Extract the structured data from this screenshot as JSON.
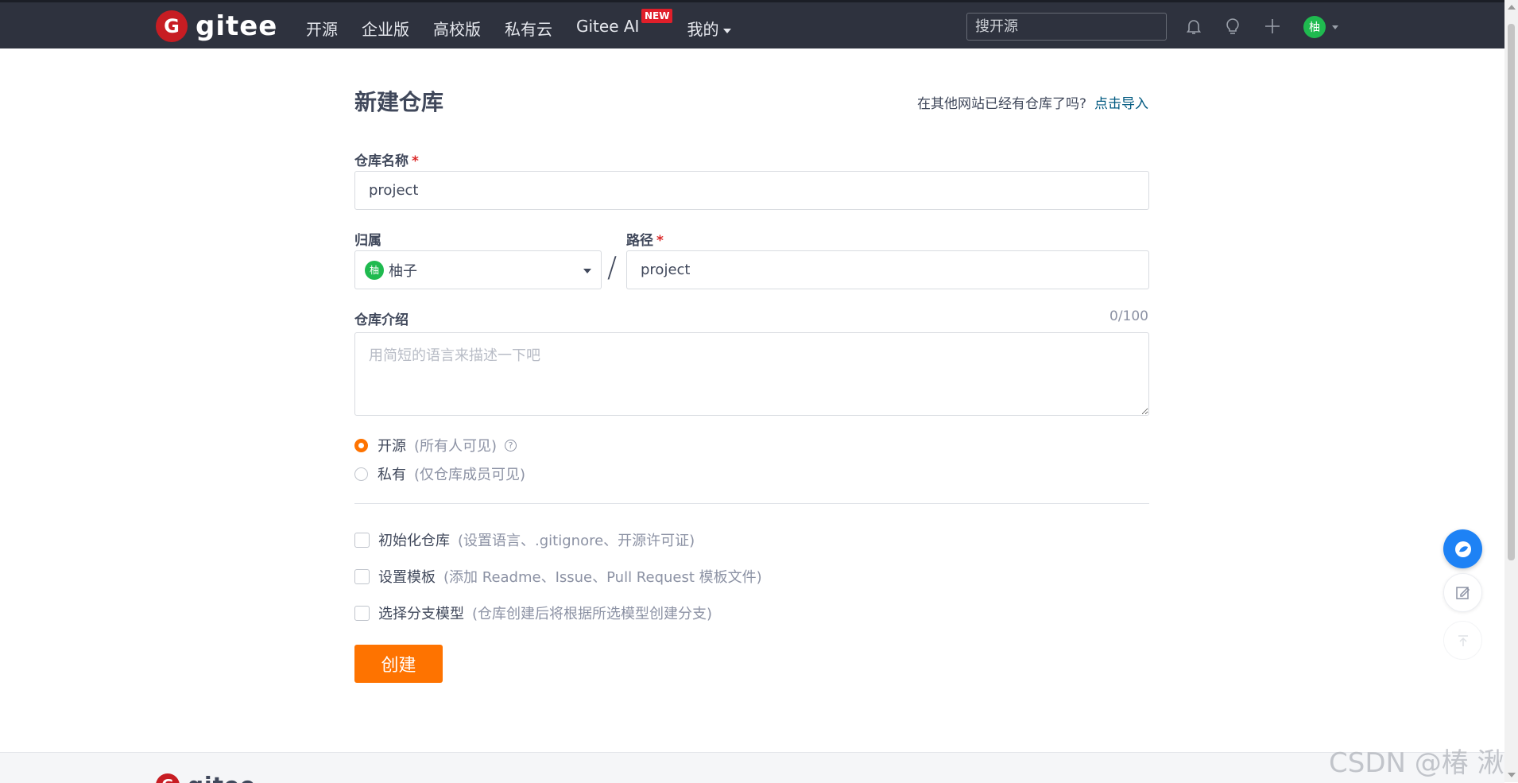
{
  "nav": {
    "logo_text": "gitee",
    "logo_letter": "G",
    "items": [
      {
        "label": "开源"
      },
      {
        "label": "企业版"
      },
      {
        "label": "高校版"
      },
      {
        "label": "私有云"
      },
      {
        "label": "Gitee AI",
        "badge": "NEW"
      },
      {
        "label": "我的"
      }
    ],
    "search_placeholder": "搜开源",
    "avatar_text": "柚"
  },
  "form": {
    "title": "新建仓库",
    "import_prompt": "在其他网站已经有仓库了吗?",
    "import_link": "点击导入",
    "repo_name_label": "仓库名称",
    "repo_name_value": "project",
    "required_mark": "*",
    "owner_label": "归属",
    "owner_avatar": "柚",
    "owner_name": "柚子",
    "separator": "/",
    "path_label": "路径",
    "path_value": "project",
    "desc_label": "仓库介绍",
    "desc_counter": "0/100",
    "desc_placeholder": "用简短的语言来描述一下吧",
    "visibility": [
      {
        "label": "开源",
        "hint": "(所有人可见)",
        "checked": true
      },
      {
        "label": "私有",
        "hint": "(仅仓库成员可见)",
        "checked": false
      }
    ],
    "help_glyph": "?",
    "options": [
      {
        "label": "初始化仓库",
        "hint": "(设置语言、.gitignore、开源许可证)"
      },
      {
        "label": "设置模板",
        "hint": "(添加 Readme、Issue、Pull Request 模板文件)"
      },
      {
        "label": "选择分支模型",
        "hint": "(仓库创建后将根据所选模型创建分支)"
      }
    ],
    "submit_label": "创建"
  },
  "footer": {
    "logo_text": "gitee"
  },
  "watermark": "CSDN @椿 湫",
  "colors": {
    "accent": "#fe7300",
    "nav_bg": "#2e323e",
    "link": "#005980",
    "brand": "#c71d23"
  }
}
